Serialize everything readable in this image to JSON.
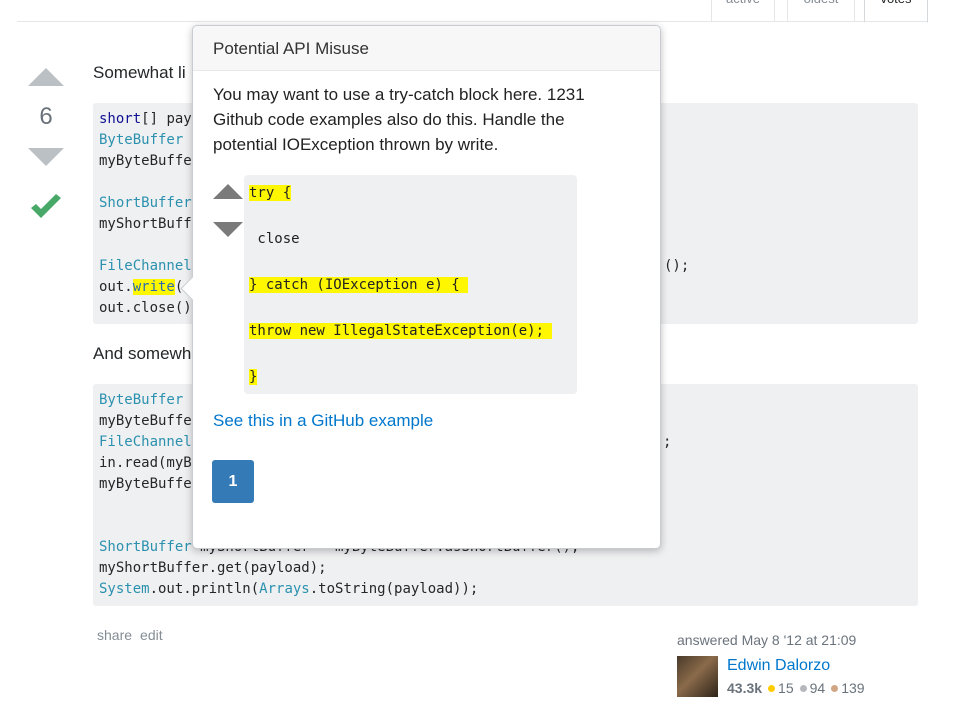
{
  "tabs": [
    {
      "label": "active"
    },
    {
      "label": "oldest"
    },
    {
      "label": "votes"
    }
  ],
  "vote": {
    "count": "6"
  },
  "answer": {
    "intro_text": "Somewhat li",
    "mid_text": "And somewh",
    "code1": [
      {
        "a": "short",
        "b": "[] pay"
      },
      {
        "a": "ByteBuffer",
        "b": ""
      },
      {
        "a": "",
        "b": "myByteBuffe"
      },
      {
        "a": "ShortBuffer",
        "b": ""
      },
      {
        "a": "",
        "b": "myShortBuff"
      },
      {
        "a": "FileChannel",
        "b": ""
      },
      {
        "a": "out.",
        "b": "write",
        "c": "("
      },
      {
        "a": "",
        "b": "out.close()"
      }
    ],
    "code1_tail": "();",
    "code2": [
      {
        "a": "ByteBuffer",
        "b": ""
      },
      {
        "a": "",
        "b": "myByteBuffe"
      },
      {
        "a": "FileChannel",
        "b": ""
      },
      {
        "a": "",
        "b": "in.read(myB"
      },
      {
        "a": "",
        "b": "myByteBuffe"
      }
    ],
    "code2_tail": ";",
    "code2_bottom": [
      {
        "t": "ShortBuffer",
        "r": " myShortBuffer = myByteBuffer.asShortBuffer();"
      },
      {
        "t": "",
        "r": "myShortBuffer.get(payload);"
      },
      {
        "t": "System",
        "r": ".out.println(",
        "t2": "Arrays",
        "r2": ".toString(payload));"
      }
    ]
  },
  "post_menu": {
    "share": "share",
    "edit": "edit"
  },
  "signature": {
    "answered": "answered May 8 '12 at 21:09",
    "user": "Edwin Dalorzo",
    "rep": "43.3k",
    "gold": "15",
    "silver": "94",
    "bronze": "139"
  },
  "popup": {
    "title": "Potential API Misuse",
    "body": "You may want to use a try-catch block here. 1231 Github code examples also do this. Handle the potential IOException thrown by write.",
    "snippet": [
      "try {",
      " close",
      "} catch (IOException e) { ",
      "throw new IllegalStateException(e); ",
      "}"
    ],
    "link": "See this in a GitHub example",
    "page": "1"
  },
  "colors": {
    "accent": "#337ab7",
    "link": "#0077cc",
    "highlight": "#fff700",
    "check": "#48a868"
  }
}
